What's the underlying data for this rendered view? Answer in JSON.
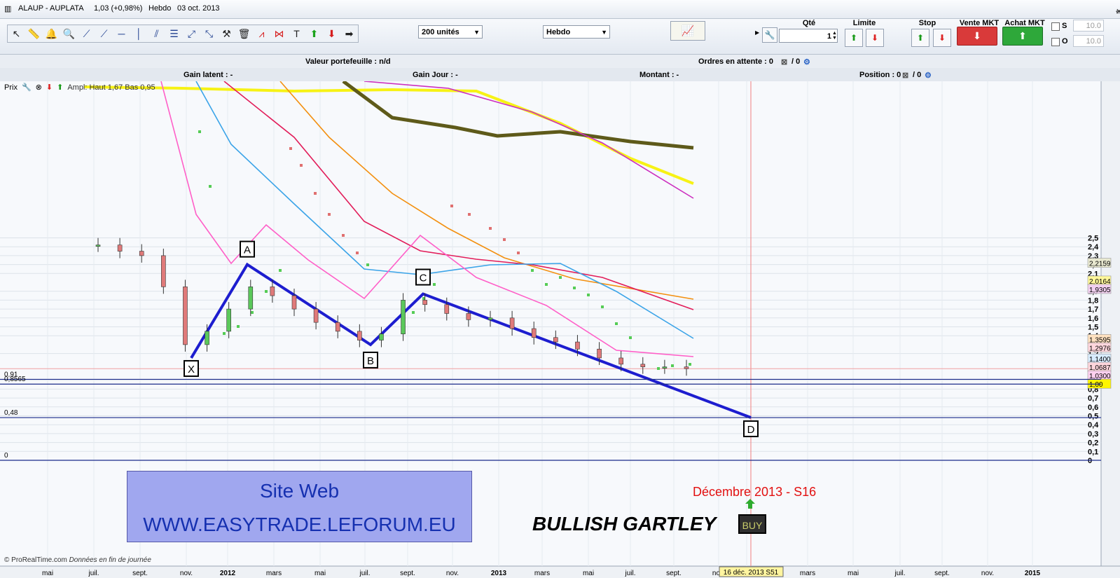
{
  "window": {
    "instrument": "ALAUP - AUPLATA",
    "change": "1,03 (+0,98%)",
    "timeframe": "Hebdo",
    "date": "03 oct. 2013"
  },
  "toolbar": {
    "units_select": "200 unités",
    "period_select": "Hebdo",
    "order": {
      "qty_label": "Qté",
      "qty_value": "1",
      "limit_label": "Limite",
      "stop_label": "Stop",
      "sell_label": "Vente MKT",
      "buy_label": "Achat MKT",
      "s_label": "S",
      "o_label": "O",
      "s_value": "10.0",
      "o_value": "10.0"
    }
  },
  "portfolio": {
    "valeur": "Valeur portefeuille : n/d",
    "ordres": "Ordres en attente : 0",
    "ordres_sep": "/ 0",
    "gain_latent": "Gain latent : -",
    "gain_jour": "Gain Jour : -",
    "montant": "Montant : -",
    "position": "Position : 0",
    "position_sep": "/ 0"
  },
  "price_panel": {
    "label": "Prix",
    "overlay_text": "Ampl: Haut 1,67 Bas 0,95"
  },
  "chart_data": {
    "type": "candlestick",
    "x_ticks": [
      "mai",
      "juil.",
      "sept.",
      "nov.",
      "2012",
      "mars",
      "mai",
      "juil.",
      "sept.",
      "nov.",
      "2013",
      "mars",
      "mai",
      "juil.",
      "sept.",
      "nov.",
      "16 déc. 2013 S51",
      "mars",
      "mai",
      "juil.",
      "sept.",
      "nov.",
      "2015"
    ],
    "y_ticks": [
      "0",
      "0,1",
      "0,2",
      "0,3",
      "0,4",
      "0,5",
      "0,6",
      "0,7",
      "0,8",
      "0,9",
      "1,2",
      "1,4",
      "1,5",
      "1,6",
      "1,7",
      "1,8",
      "1,9",
      "2,1",
      "2,2",
      "2,3",
      "2,4",
      "2,5"
    ],
    "ylim": [
      0,
      2.6
    ],
    "horizontal_levels": [
      "0,91",
      "0,8565",
      "0,48",
      "0"
    ],
    "right_tags": [
      "2,2159",
      "2,0164",
      "1,9305",
      "1,3595",
      "1,2976",
      "1,1400",
      "1,0687",
      "1,0300",
      "1,00"
    ],
    "pattern_points": [
      "X",
      "A",
      "B",
      "C",
      "D"
    ],
    "pattern_values": [
      1.15,
      2.2,
      1.3,
      1.87,
      0.48
    ],
    "candles": [
      [
        "juil.",
        2.42
      ],
      [
        "août",
        2.35
      ],
      [
        "sept.",
        2.3
      ],
      [
        "oct.",
        1.95
      ],
      [
        "nov.",
        1.3
      ],
      [
        "déc.",
        1.45
      ],
      [
        "janv.",
        1.7
      ],
      [
        "févr.",
        1.95
      ],
      [
        "mars",
        1.85
      ],
      [
        "avr.",
        1.7
      ],
      [
        "mai",
        1.55
      ],
      [
        "juin",
        1.45
      ],
      [
        "juil.",
        1.35
      ],
      [
        "août",
        1.42
      ],
      [
        "sept.",
        1.8
      ],
      [
        "oct.",
        1.75
      ],
      [
        "nov.",
        1.65
      ],
      [
        "déc.",
        1.58
      ],
      [
        "janv.",
        1.6
      ],
      [
        "févr.",
        1.48
      ],
      [
        "mars",
        1.38
      ],
      [
        "avr.",
        1.33
      ],
      [
        "mai",
        1.25
      ],
      [
        "juin",
        1.15
      ],
      [
        "juil.",
        1.08
      ],
      [
        "août",
        1.05
      ],
      [
        "sept.",
        1.05
      ],
      [
        "oct.",
        1.03
      ]
    ]
  },
  "annotations": {
    "website": "Site Web",
    "url": "WWW.EASYTRADE.LEFORUM.EU",
    "pattern_name": "BULLISH GARTLEY",
    "buy": "BUY",
    "target": "Décembre 2013 - S16"
  },
  "footer": {
    "source": "© ProRealTime.com",
    "note": "Données en fin de journée"
  }
}
